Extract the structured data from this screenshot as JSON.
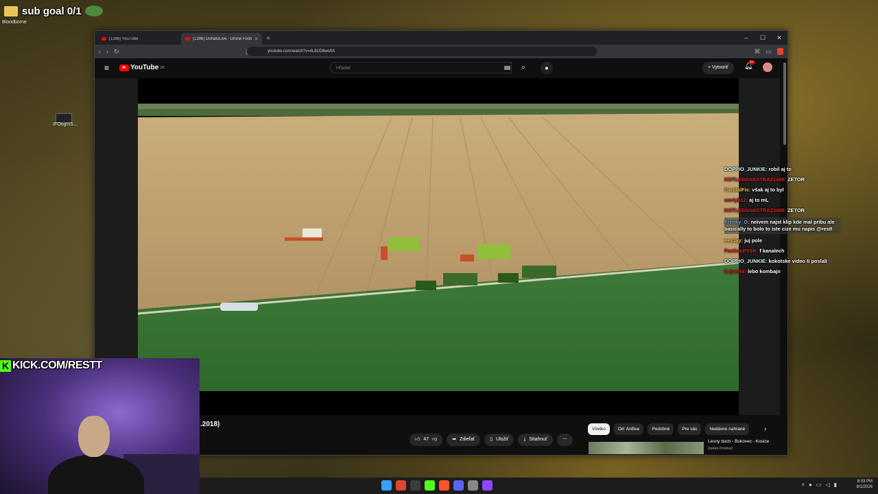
{
  "desktop": {
    "sub_goal": "sub goal 0/1",
    "folder_label": "Bloodborne",
    "shortcut_label": "IFOng!nS…"
  },
  "browser": {
    "tabs": [
      {
        "label": "(1396) YouTube",
        "active": false
      },
      {
        "label": "(1396) DonatoLive - Drone Footi…",
        "active": true
      }
    ],
    "new_tab": "+",
    "url": "youtube.com/watch?v=4L8UD6wsfIA",
    "window_controls": [
      "–",
      "☐",
      "✕"
    ]
  },
  "youtube": {
    "logo_text": "YouTube",
    "region": "SK",
    "search_placeholder": "Hľadať",
    "create_label": "+ Vytvoriť",
    "notif_count": "9+",
    "video_title_fragment": ".2018)",
    "like_count": "47",
    "actions": {
      "share": "Zdieľať",
      "save": "Uložiť",
      "download": "Stiahnuť",
      "more": "⋯"
    },
    "chips": [
      "Všetko",
      "Od: AnBee",
      "Podobné",
      "Pre vás",
      "Nedávno nahrané"
    ],
    "recommendation": {
      "title": "Lesny duch - Bukovec - Kosice",
      "channel": "Zeden Product"
    }
  },
  "chat": [
    {
      "user": "DOPPIO_JUNKIE:",
      "text": "robil aj to",
      "color": "plain"
    },
    {
      "user": "KOTLEBANASTRAZ1488:",
      "text": "ZETOR",
      "color": "red"
    },
    {
      "user": "GandalFis:",
      "text": "však aj to byl",
      "color": "gold"
    },
    {
      "user": "wertyk12:",
      "text": "aj to mL",
      "color": "red"
    },
    {
      "user": "KOTLEBANASTRAZ1488:",
      "text": "ZETOR",
      "color": "red"
    },
    {
      "user": "Frenky_O:",
      "text": "neivem najst klip kde mal pribu ale basically to bolo to iste cize mu napis @restt",
      "color": "blue"
    },
    {
      "user": "eesJay:",
      "text": "juj pole",
      "color": "gold"
    },
    {
      "user": "PochvoPYSK:",
      "text": "f kanalech",
      "color": "red"
    },
    {
      "user": "DOPPIO_JUNKIE:",
      "text": "kokotske video ti poslali",
      "color": "plain"
    },
    {
      "user": "bejoel68:",
      "text": "lebo kombajn",
      "color": "red"
    }
  ],
  "overlay": {
    "kick_url": "KICK.COM/RESTT"
  },
  "taskbar": {
    "time": "8:03 PM",
    "date": "8/1/2026"
  },
  "colors": {
    "accent_red": "#ff0000",
    "kick_green": "#53fc18"
  }
}
